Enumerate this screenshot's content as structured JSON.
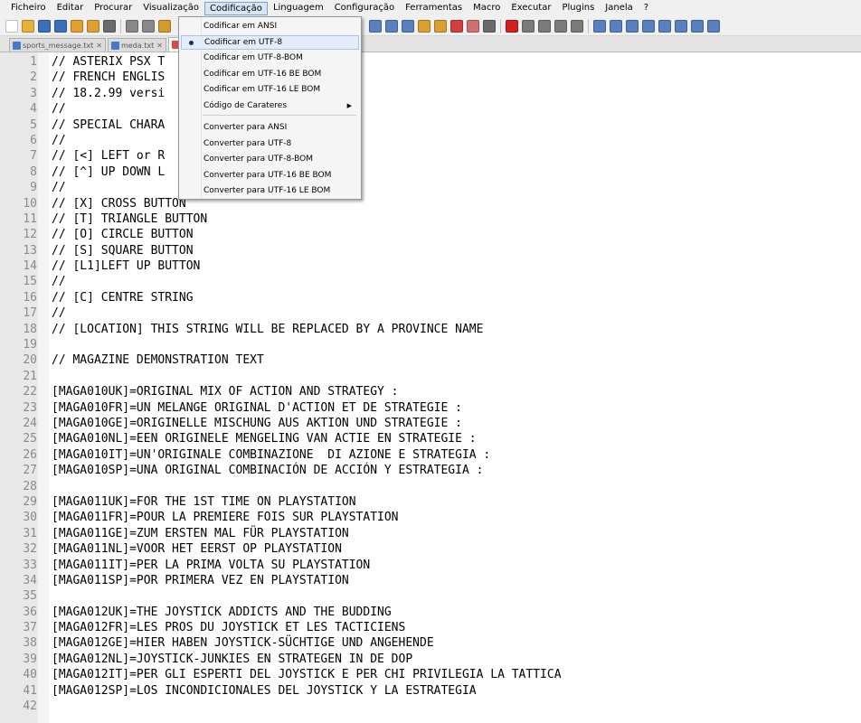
{
  "menubar": {
    "items": [
      "Ficheiro",
      "Editar",
      "Procurar",
      "Visualização",
      "Codificação",
      "Linguagem",
      "Configuração",
      "Ferramentas",
      "Macro",
      "Executar",
      "Plugins",
      "Janela",
      "?"
    ]
  },
  "tabs": [
    {
      "label": "sports_message.txt"
    },
    {
      "label": "meda.txt"
    },
    {
      "label": ""
    }
  ],
  "encoding_menu": {
    "items": [
      {
        "label": "Codificar em ANSI"
      },
      {
        "label": "Codificar em UTF-8"
      },
      {
        "label": "Codificar em UTF-8-BOM"
      },
      {
        "label": "Codificar em UTF-16 BE BOM"
      },
      {
        "label": "Codificar em UTF-16 LE BOM"
      },
      {
        "label": "Código de Carateres"
      },
      {
        "label": "Converter para ANSI"
      },
      {
        "label": "Converter para UTF-8"
      },
      {
        "label": "Converter para UTF-8-BOM"
      },
      {
        "label": "Converter para UTF-16 BE BOM"
      },
      {
        "label": "Converter para UTF-16 LE BOM"
      }
    ],
    "selected_label": "Codificar em UTF-8",
    "submenu_label": "Código de Carateres"
  },
  "editor": {
    "lines": [
      {
        "n": "1",
        "t": "// ASTERIX PSX T"
      },
      {
        "n": "2",
        "t": "// FRENCH ENGLIS"
      },
      {
        "n": "3",
        "t": "// 18.2.99 versi"
      },
      {
        "n": "4",
        "t": "//"
      },
      {
        "n": "5",
        "t": "// SPECIAL CHARA"
      },
      {
        "n": "6",
        "t": "//"
      },
      {
        "n": "7",
        "t": "// [<] LEFT or R                  S"
      },
      {
        "n": "8",
        "t": "// [^] UP DOWN L                  UTTONS"
      },
      {
        "n": "9",
        "t": "//"
      },
      {
        "n": "10",
        "t": "// [X] CROSS BUTTON"
      },
      {
        "n": "11",
        "t": "// [T] TRIANGLE BUTTON"
      },
      {
        "n": "12",
        "t": "// [O] CIRCLE BUTTON"
      },
      {
        "n": "13",
        "t": "// [S] SQUARE BUTTON"
      },
      {
        "n": "14",
        "t": "// [L1]LEFT UP BUTTON"
      },
      {
        "n": "15",
        "t": "//"
      },
      {
        "n": "16",
        "t": "// [C] CENTRE STRING"
      },
      {
        "n": "17",
        "t": "//"
      },
      {
        "n": "18",
        "t": "// [LOCATION] THIS STRING WILL BE REPLACED BY A PROVINCE NAME"
      },
      {
        "n": "19",
        "t": ""
      },
      {
        "n": "20",
        "t": "// MAGAZINE DEMONSTRATION TEXT"
      },
      {
        "n": "21",
        "t": ""
      },
      {
        "n": "22",
        "t": "[MAGA010UK]=ORIGINAL MIX OF ACTION AND STRATEGY :"
      },
      {
        "n": "23",
        "t": "[MAGA010FR]=UN MELANGE ORIGINAL D'ACTION ET DE STRATEGIE :"
      },
      {
        "n": "24",
        "t": "[MAGA010GE]=ORIGINELLE MISCHUNG AUS AKTION UND STRATEGIE :"
      },
      {
        "n": "25",
        "t": "[MAGA010NL]=EEN ORIGINELE MENGELING VAN ACTIE EN STRATEGIE :"
      },
      {
        "n": "26",
        "t": "[MAGA010IT]=UN'ORIGINALE COMBINAZIONE  DI AZIONE E STRATEGIA :"
      },
      {
        "n": "27",
        "t": "[MAGA010SP]=UNA ORIGINAL COMBINACIÓN DE ACCIÓN Y ESTRATEGIA :"
      },
      {
        "n": "28",
        "t": ""
      },
      {
        "n": "29",
        "t": "[MAGA011UK]=FOR THE 1ST TIME ON PLAYSTATION"
      },
      {
        "n": "30",
        "t": "[MAGA011FR]=POUR LA PREMIERE FOIS SUR PLAYSTATION"
      },
      {
        "n": "31",
        "t": "[MAGA011GE]=ZUM ERSTEN MAL FÜR PLAYSTATION"
      },
      {
        "n": "32",
        "t": "[MAGA011NL]=VOOR HET EERST OP PLAYSTATION"
      },
      {
        "n": "33",
        "t": "[MAGA011IT]=PER LA PRIMA VOLTA SU PLAYSTATION"
      },
      {
        "n": "34",
        "t": "[MAGA011SP]=POR PRIMERA VEZ EN PLAYSTATION"
      },
      {
        "n": "35",
        "t": ""
      },
      {
        "n": "36",
        "t": "[MAGA012UK]=THE JOYSTICK ADDICTS AND THE BUDDING"
      },
      {
        "n": "37",
        "t": "[MAGA012FR]=LES PROS DU JOYSTICK ET LES TACTICIENS"
      },
      {
        "n": "38",
        "t": "[MAGA012GE]=HIER HABEN JOYSTICK-SÜCHTIGE UND ANGEHENDE"
      },
      {
        "n": "39",
        "t": "[MAGA012NL]=JOYSTICK-JUNKIES EN STRATEGEN IN DE DOP"
      },
      {
        "n": "40",
        "t": "[MAGA012IT]=PER GLI ESPERTI DEL JOYSTICK E PER CHI PRIVILEGIA LA TATTICA"
      },
      {
        "n": "41",
        "t": "[MAGA012SP]=LOS INCONDICIONALES DEL JOYSTICK Y LA ESTRATEGIA"
      },
      {
        "n": "42",
        "t": ""
      }
    ]
  },
  "toolbar": {
    "icons": [
      {
        "name": "new-file-icon",
        "color": "#ffffff"
      },
      {
        "name": "open-file-icon",
        "color": "#e7b13c"
      },
      {
        "name": "save-icon",
        "color": "#3d6fb8"
      },
      {
        "name": "save-all-icon",
        "color": "#3d6fb8"
      },
      {
        "name": "close-icon",
        "color": "#e0a030"
      },
      {
        "name": "close-all-icon",
        "color": "#e0a030"
      },
      {
        "name": "print-icon",
        "color": "#6b6b6b"
      },
      {
        "name": "sep"
      },
      {
        "name": "cut-icon",
        "color": "#888888"
      },
      {
        "name": "copy-icon",
        "color": "#888888"
      },
      {
        "name": "paste-icon",
        "color": "#d59a2e"
      }
    ],
    "icons_right": [
      {
        "name": "word-wrap-icon",
        "color": "#5a7fbf"
      },
      {
        "name": "show-all-chars-icon",
        "color": "#5a7fbf"
      },
      {
        "name": "indent-guide-icon",
        "color": "#5a7fbf"
      },
      {
        "name": "user-lang-icon",
        "color": "#d9a030"
      },
      {
        "name": "doc-map-icon",
        "color": "#d9a030"
      },
      {
        "name": "function-list-icon",
        "color": "#d04040"
      },
      {
        "name": "folder-workspace-icon",
        "color": "#d07070"
      },
      {
        "name": "monitoring-icon",
        "color": "#6a6a6a"
      },
      {
        "name": "sep"
      },
      {
        "name": "record-macro-icon",
        "color": "#d02020"
      },
      {
        "name": "stop-macro-icon",
        "color": "#7a7a7a"
      },
      {
        "name": "play-macro-icon",
        "color": "#7a7a7a"
      },
      {
        "name": "run-macro-multiple-icon",
        "color": "#7a7a7a"
      },
      {
        "name": "save-macro-icon",
        "color": "#7a7a7a"
      },
      {
        "name": "sep"
      },
      {
        "name": "plugin-1-icon",
        "color": "#5a7fbf"
      },
      {
        "name": "plugin-2-icon",
        "color": "#5a7fbf"
      },
      {
        "name": "plugin-3-icon",
        "color": "#5a7fbf"
      },
      {
        "name": "plugin-4-icon",
        "color": "#5a7fbf"
      },
      {
        "name": "plugin-5-icon",
        "color": "#5a7fbf"
      },
      {
        "name": "plugin-6-icon",
        "color": "#5a7fbf"
      },
      {
        "name": "plugin-7-icon",
        "color": "#5a7fbf"
      },
      {
        "name": "plugin-8-icon",
        "color": "#5a7fbf"
      }
    ]
  }
}
